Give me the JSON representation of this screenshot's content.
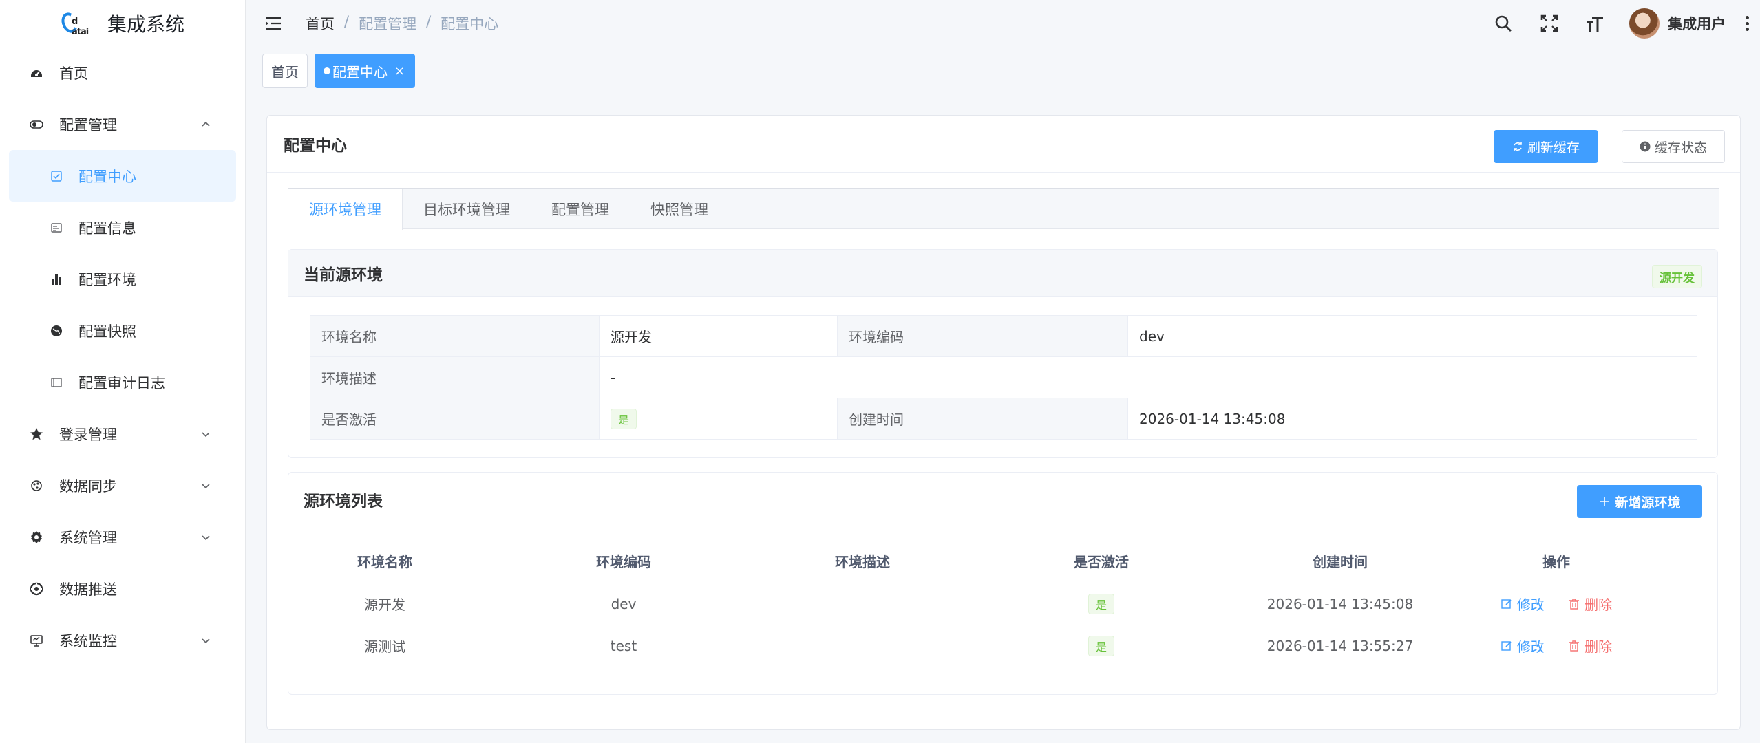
{
  "app": {
    "logo_text": "d atai",
    "title": "集成系统"
  },
  "sidebar": {
    "items": [
      {
        "label": "首页",
        "icon": "dashboard-icon"
      },
      {
        "label": "配置管理",
        "icon": "toggle-icon",
        "expanded": true
      },
      {
        "label": "登录管理",
        "icon": "star-icon"
      },
      {
        "label": "数据同步",
        "icon": "sync-icon"
      },
      {
        "label": "系统管理",
        "icon": "gear-icon"
      },
      {
        "label": "数据推送",
        "icon": "push-icon"
      },
      {
        "label": "系统监控",
        "icon": "monitor-icon"
      }
    ],
    "config_children": [
      {
        "label": "配置中心",
        "icon": "check-square-icon",
        "active": true
      },
      {
        "label": "配置信息",
        "icon": "form-icon"
      },
      {
        "label": "配置环境",
        "icon": "chart-icon"
      },
      {
        "label": "配置快照",
        "icon": "globe-icon"
      },
      {
        "label": "配置审计日志",
        "icon": "log-icon"
      }
    ]
  },
  "header": {
    "breadcrumb": [
      "首页",
      "/",
      "配置管理",
      "/",
      "配置中心"
    ],
    "user_name": "集成用户"
  },
  "tags": {
    "home": "首页",
    "active": "配置中心",
    "close": "×"
  },
  "card": {
    "title": "配置中心",
    "refresh_label": "刷新缓存",
    "status_label": "缓存状态"
  },
  "tabs": [
    "源环境管理",
    "目标环境管理",
    "配置管理",
    "快照管理"
  ],
  "current_env": {
    "title": "当前源环境",
    "tag": "源开发",
    "fields": {
      "name_label": "环境名称",
      "name_value": "源开发",
      "code_label": "环境编码",
      "code_value": "dev",
      "desc_label": "环境描述",
      "desc_value": "-",
      "active_label": "是否激活",
      "active_value": "是",
      "created_label": "创建时间",
      "created_value": "2026-01-14 13:45:08"
    }
  },
  "env_list": {
    "title": "源环境列表",
    "add_label": "新增源环境",
    "columns": [
      "环境名称",
      "环境编码",
      "环境描述",
      "是否激活",
      "创建时间",
      "操作"
    ],
    "rows": [
      {
        "name": "源开发",
        "code": "dev",
        "desc": "",
        "active": "是",
        "created": "2026-01-14 13:45:08"
      },
      {
        "name": "源测试",
        "code": "test",
        "desc": "",
        "active": "是",
        "created": "2026-01-14 13:55:27"
      }
    ],
    "edit_label": "修改",
    "delete_label": "删除"
  },
  "colors": {
    "primary": "#409eff",
    "success": "#67c23a",
    "danger": "#f56c6c"
  }
}
